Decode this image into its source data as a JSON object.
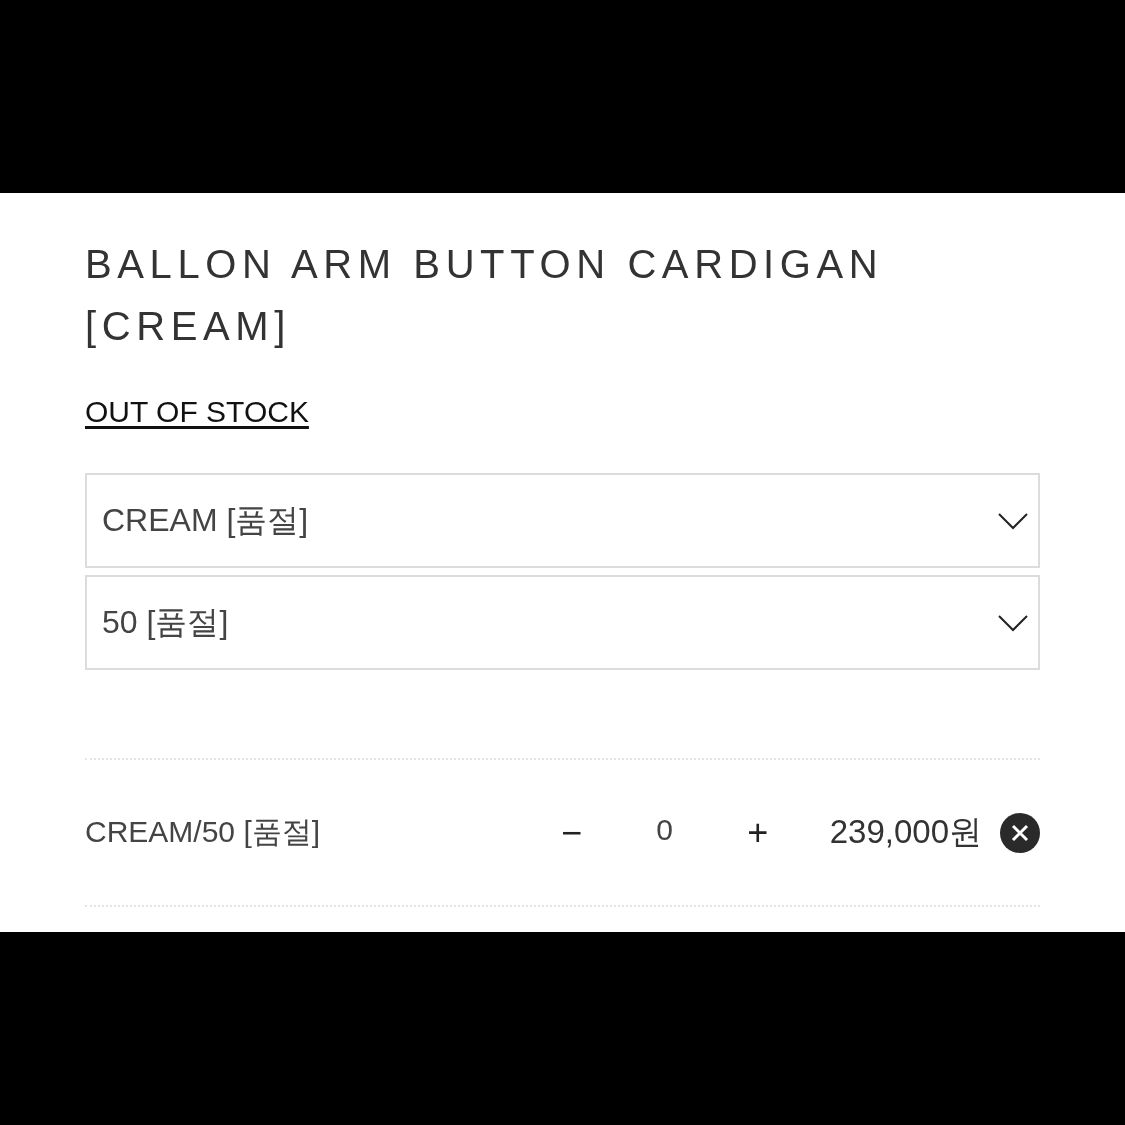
{
  "product": {
    "title": "BALLON ARM BUTTON CARDIGAN [CREAM]",
    "stock_link": "OUT OF STOCK"
  },
  "options": [
    {
      "value": "CREAM [품절]"
    },
    {
      "value": "50 [품절]"
    }
  ],
  "cart_line": {
    "name": "CREAM/50 [품절]",
    "minus": "−",
    "quantity": "0",
    "plus": "+",
    "price": "239,000원"
  }
}
